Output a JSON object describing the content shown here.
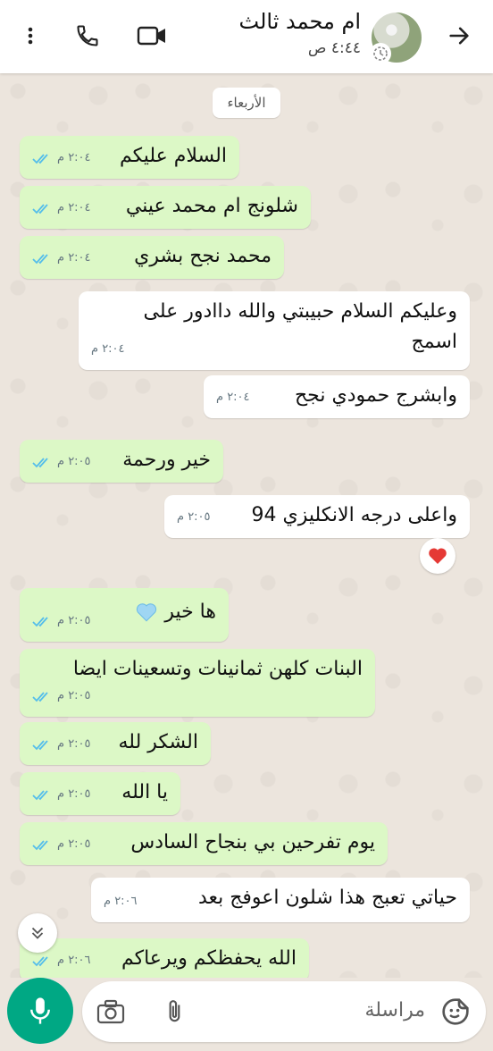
{
  "header": {
    "contact_name": "ام محمد ثالث",
    "last_seen": "٤:٤٤ ص",
    "icons": [
      "back-arrow-icon",
      "video-call-icon",
      "phone-call-icon",
      "more-options-icon"
    ]
  },
  "chat": {
    "date_label": "الأربعاء",
    "messages": [
      {
        "dir": "out",
        "text": "السلام عليكم",
        "time": "٢:٠٤ م"
      },
      {
        "dir": "out",
        "text": "شلونج ام محمد عيني",
        "time": "٢:٠٤ م"
      },
      {
        "dir": "out",
        "text": "محمد نجح بشري",
        "time": "٢:٠٤ م"
      },
      {
        "dir": "in",
        "text": "وعليكم السلام حبيبتي والله داادور على اسمج",
        "time": "٢:٠٤ م"
      },
      {
        "dir": "in",
        "text": "وابشرج حمودي نجح",
        "time": "٢:٠٤ م"
      },
      {
        "dir": "out",
        "text": "خير ورحمة",
        "time": "٢:٠٥ م"
      },
      {
        "dir": "in",
        "text": "واعلى درجه الانكليزي 94",
        "time": "٢:٠٥ م"
      },
      {
        "dir": "out",
        "text": "ها خير",
        "time": "٢:٠٥ م"
      },
      {
        "dir": "out",
        "text": "البنات كلهن ثمانينات وتسعينات ايضا",
        "time": "٢:٠٥ م"
      },
      {
        "dir": "out",
        "text": "الشكر لله",
        "time": "٢:٠٥ م"
      },
      {
        "dir": "out",
        "text": "يا الله",
        "time": "٢:٠٥ م"
      },
      {
        "dir": "out",
        "text": "يوم تفرحين بي بنجاح السادس",
        "time": "٢:٠٥ م"
      },
      {
        "dir": "in",
        "text": "حياتي تعبج هذا شلون اعوفج بعد",
        "time": "٢:٠٦ م"
      },
      {
        "dir": "out",
        "text": "الله يحفظكم ويرعاكم",
        "time": "٢:٠٦ م"
      }
    ],
    "reaction": "red-heart"
  },
  "composer": {
    "placeholder": "مراسلة"
  },
  "colors": {
    "outgoing_bubble": "#dcf8c6",
    "incoming_bubble": "#ffffff",
    "accent": "#00a884",
    "read_ticks": "#53bdeb"
  }
}
